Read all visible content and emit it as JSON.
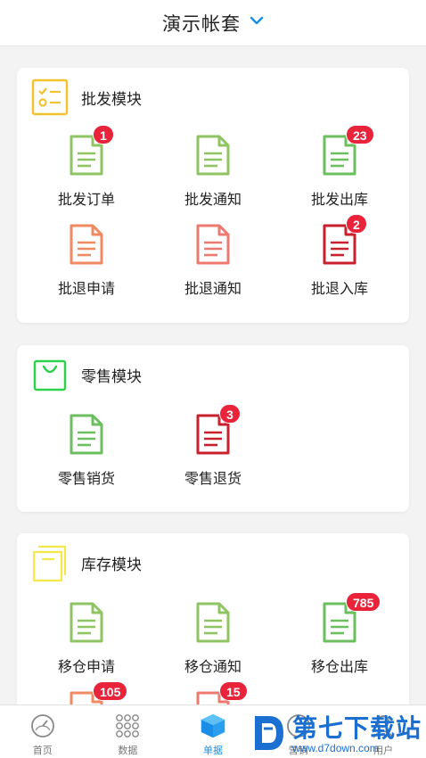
{
  "header": {
    "title": "演示帐套"
  },
  "modules": [
    {
      "title": "批发模块",
      "icon": "checklist-icon",
      "items": [
        {
          "label": "批发订单",
          "badge": "1",
          "color": "#8fc462"
        },
        {
          "label": "批发通知",
          "badge": "",
          "color": "#8fc462"
        },
        {
          "label": "批发出库",
          "badge": "23",
          "color": "#6cbf5f"
        },
        {
          "label": "批退申请",
          "badge": "",
          "color": "#f08a60"
        },
        {
          "label": "批退通知",
          "badge": "",
          "color": "#ec7a70"
        },
        {
          "label": "批退入库",
          "badge": "2",
          "color": "#c8202c"
        }
      ]
    },
    {
      "title": "零售模块",
      "icon": "shopping-bag-icon",
      "items": [
        {
          "label": "零售销货",
          "badge": "",
          "color": "#6cbf5f"
        },
        {
          "label": "零售退货",
          "badge": "3",
          "color": "#c8202c"
        }
      ]
    },
    {
      "title": "库存模块",
      "icon": "warehouse-icon",
      "items": [
        {
          "label": "移仓申请",
          "badge": "",
          "color": "#8fc462"
        },
        {
          "label": "移仓通知",
          "badge": "",
          "color": "#8fc462"
        },
        {
          "label": "移仓出库",
          "badge": "785",
          "color": "#6cbf5f"
        },
        {
          "label": "",
          "badge": "105",
          "color": "#f08a60"
        },
        {
          "label": "",
          "badge": "15",
          "color": "#ec7a70"
        }
      ]
    }
  ],
  "tabs": [
    {
      "label": "首页",
      "icon": "speedometer-icon"
    },
    {
      "label": "数据",
      "icon": "grid-dots-icon"
    },
    {
      "label": "单据",
      "icon": "cube-icon"
    },
    {
      "label": "营销",
      "icon": "marketing-icon"
    },
    {
      "label": "用户",
      "icon": "user-icon"
    }
  ],
  "watermark": {
    "main": "第七下载站",
    "sub": "www.d7down.com"
  }
}
